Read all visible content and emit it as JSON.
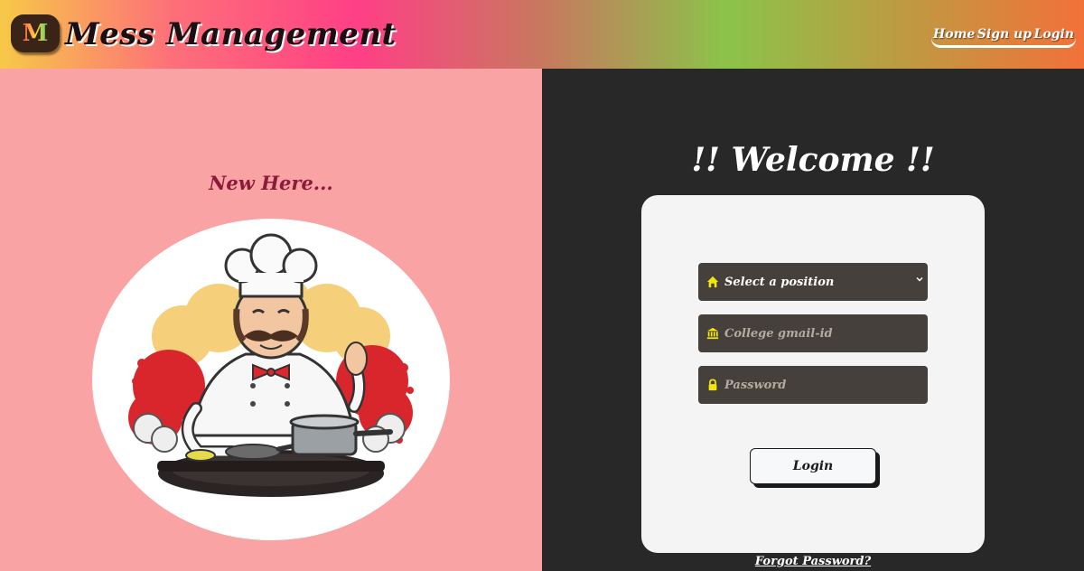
{
  "header": {
    "logo_letter": "M",
    "brand_title": "Mess Management",
    "nav": [
      {
        "label": "Home"
      },
      {
        "label": "Sign up"
      },
      {
        "label": "Login"
      }
    ]
  },
  "left_panel": {
    "heading": "New Here...",
    "illustration": "chef-illustration"
  },
  "login": {
    "title": "!! Welcome !!",
    "position_select": {
      "value": "Select a position",
      "icon": "home-icon"
    },
    "email_field": {
      "placeholder": "College gmail-id",
      "icon": "bank-icon"
    },
    "password_field": {
      "placeholder": "Password",
      "icon": "lock-icon"
    },
    "submit_label": "Login",
    "forgot_link": "Forgot Password?"
  },
  "colors": {
    "left_bg": "#f9a3a4",
    "right_bg": "#282828",
    "field_bg": "#45403b",
    "icon_yellow": "#f5e60a",
    "heading_accent": "#8c1b3a"
  }
}
